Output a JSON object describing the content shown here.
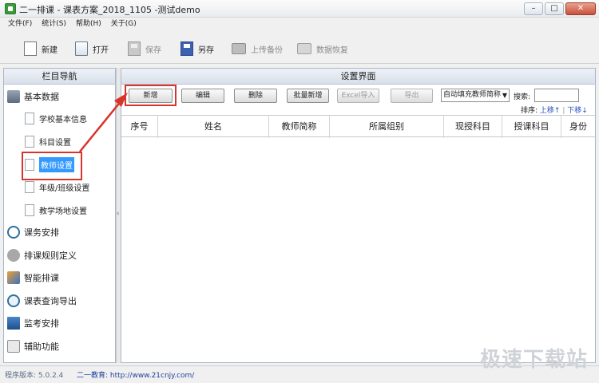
{
  "window": {
    "title": "二一排课 - 课表方案_2018_1105 -测试demo",
    "controls": {
      "minimize": "–",
      "maximize": "□",
      "close": "✕"
    }
  },
  "menu": [
    "文件(F)",
    "统计(S)",
    "帮助(H)",
    "关于(G)"
  ],
  "toolbar": {
    "new": "新建",
    "open": "打开",
    "save": "保存",
    "save_as": "另存",
    "upload_backup": "上传备份",
    "data_restore": "数据恢复"
  },
  "nav": {
    "title": "栏目导航",
    "groups": [
      {
        "label": "基本数据",
        "icon": "database-icon"
      },
      {
        "label": "课务安排",
        "icon": "clock-icon"
      },
      {
        "label": "排课规则定义",
        "icon": "gear-icon"
      },
      {
        "label": "智能排课",
        "icon": "magic-icon"
      },
      {
        "label": "课表查询导出",
        "icon": "magnifier-icon"
      },
      {
        "label": "监考安排",
        "icon": "monitor-icon"
      },
      {
        "label": "辅助功能",
        "icon": "book-icon"
      }
    ],
    "sub_items": [
      "学校基本信息",
      "科目设置",
      "教师设置",
      "年级/班级设置",
      "教学场地设置"
    ],
    "active_sub": "教师设置",
    "collapse_glyph": "‹"
  },
  "main": {
    "title": "设置界面",
    "buttons": {
      "add": "新增",
      "edit": "编辑",
      "delete": "删除",
      "batch_add": "批量新增",
      "excel_import": "Excel导入",
      "export": "导出"
    },
    "fill_mode": "自动填充教师简称",
    "search_label": "搜索:",
    "search_value": "",
    "sort_label": "排序:",
    "move_up": "上移↑",
    "move_down": "下移↓",
    "columns": [
      "序号",
      "姓名",
      "教师简称",
      "所属组别",
      "现授科目",
      "授课科目",
      "身份"
    ]
  },
  "status": {
    "version": "程序版本: 5.0.2.4",
    "site": "二一教育: http://www.21cnjy.com/"
  },
  "watermark": "极速下载站",
  "colors": {
    "highlight": "#d9342b",
    "active": "#3399ff",
    "link": "#1f4fbf"
  }
}
